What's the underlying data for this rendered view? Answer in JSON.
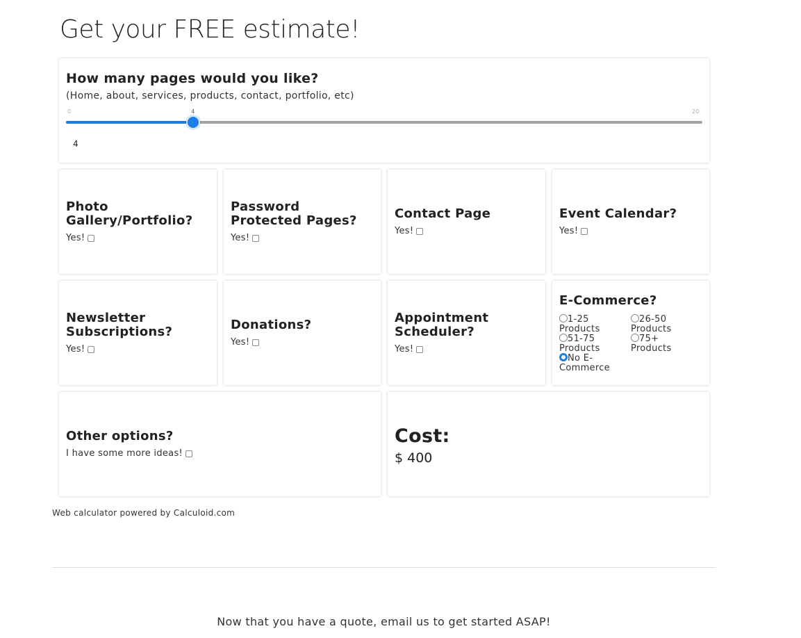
{
  "page_title": "Get your FREE estimate!",
  "pages": {
    "title": "How many pages would you like?",
    "subtitle": "(Home, about, services, products, contact, portfolio, etc)",
    "min": 0,
    "max": 20,
    "value": 4,
    "min_label": "0",
    "max_label": "20",
    "value_label": "4",
    "value_display": "4"
  },
  "options": {
    "photo_gallery": {
      "title": "Photo Gallery/Portfolio?",
      "yes": "Yes!"
    },
    "password": {
      "title": "Password Protected Pages?",
      "yes": "Yes!"
    },
    "contact": {
      "title": "Contact Page",
      "yes": "Yes!"
    },
    "event_calendar": {
      "title": "Event Calendar?",
      "yes": "Yes!"
    },
    "newsletter": {
      "title": "Newsletter Subscriptions?",
      "yes": "Yes!"
    },
    "donations": {
      "title": "Donations?",
      "yes": "Yes!"
    },
    "appointment": {
      "title": "Appointment Scheduler?",
      "yes": "Yes!"
    },
    "other": {
      "title": "Other options?",
      "yes": "I have some more ideas!"
    }
  },
  "ecommerce": {
    "title": "E-Commerce?",
    "choices": [
      {
        "label": "1-25 Products",
        "checked": false
      },
      {
        "label": "26-50 Products",
        "checked": false
      },
      {
        "label": "51-75 Products",
        "checked": false
      },
      {
        "label": "75+ Products",
        "checked": false
      },
      {
        "label": "No E-Commerce",
        "checked": true
      }
    ]
  },
  "cost": {
    "title": "Cost:",
    "value": "$ 400"
  },
  "footer": {
    "powered": "Web calculator powered by Calculoid.com",
    "cta": "Now that you have a quote, email us to get started ASAP!"
  },
  "colors": {
    "accent": "#1e7ee8",
    "track": "#a3a3a3"
  }
}
